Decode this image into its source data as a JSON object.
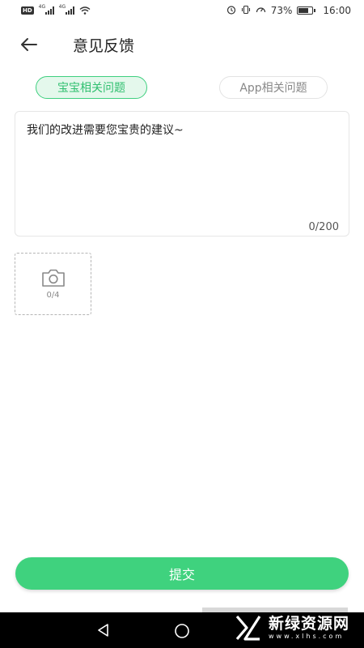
{
  "status_bar": {
    "badge": "HD",
    "sim1": "4G",
    "sim2": "4G",
    "battery_percent": "73%",
    "battery_level": 0.73,
    "time": "16:00"
  },
  "header": {
    "back_icon": "arrow-left-icon",
    "title": "意见反馈"
  },
  "tabs": [
    {
      "label": "宝宝相关问题",
      "active": true
    },
    {
      "label": "App相关问题",
      "active": false
    }
  ],
  "feedback": {
    "value": "",
    "placeholder": "我们的改进需要您宝贵的建议~",
    "count_text": "0/200"
  },
  "photo": {
    "icon": "camera-icon",
    "count_text": "0/4"
  },
  "submit_label": "提交",
  "nav_bar": {
    "back_icon": "triangle-back-icon",
    "home_icon": "circle-home-icon"
  },
  "watermark": {
    "logo": "xinlv-logo",
    "main": "新绿资源网",
    "sub": "www.xlhs.com"
  },
  "colors": {
    "accent": "#3fd27e",
    "accent_text": "#2fbf6f",
    "tab_active_bg": "#e4f8ec"
  }
}
